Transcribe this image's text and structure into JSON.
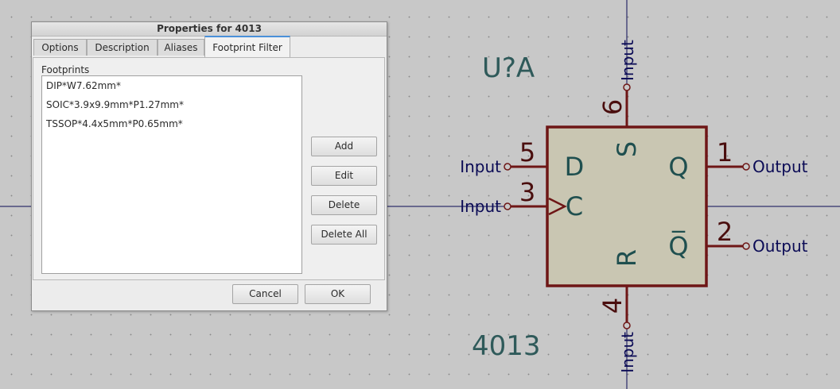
{
  "dialog": {
    "title": "Properties for 4013",
    "tabs": [
      "Options",
      "Description",
      "Aliases",
      "Footprint Filter"
    ],
    "active_tab": "Footprint Filter",
    "footprints_label": "Footprints",
    "footprints": [
      "DIP*W7.62mm*",
      "SOIC*3.9x9.9mm*P1.27mm*",
      "TSSOP*4.4x5mm*P0.65mm*"
    ],
    "buttons": {
      "add": "Add",
      "edit": "Edit",
      "delete": "Delete",
      "delete_all": "Delete All"
    },
    "cancel": "Cancel",
    "ok": "OK"
  },
  "schematic": {
    "reference": "U?A",
    "value": "4013",
    "colors": {
      "body_fill": "#c9c6b2",
      "outline": "#7a1a1a",
      "field_text": "#2f5a5a",
      "pin_name": "#1f4f4f",
      "pin_label": "#0a0a55",
      "wire": "#0a0a55"
    },
    "pins": [
      {
        "number": "5",
        "name": "D",
        "type": "Input"
      },
      {
        "number": "3",
        "name": "C",
        "type": "Input"
      },
      {
        "number": "6",
        "name": "S",
        "type": "Input"
      },
      {
        "number": "4",
        "name": "R",
        "type": "Input"
      },
      {
        "number": "1",
        "name": "Q",
        "type": "Output"
      },
      {
        "number": "2",
        "name": "Q̅",
        "type": "Output"
      }
    ]
  }
}
